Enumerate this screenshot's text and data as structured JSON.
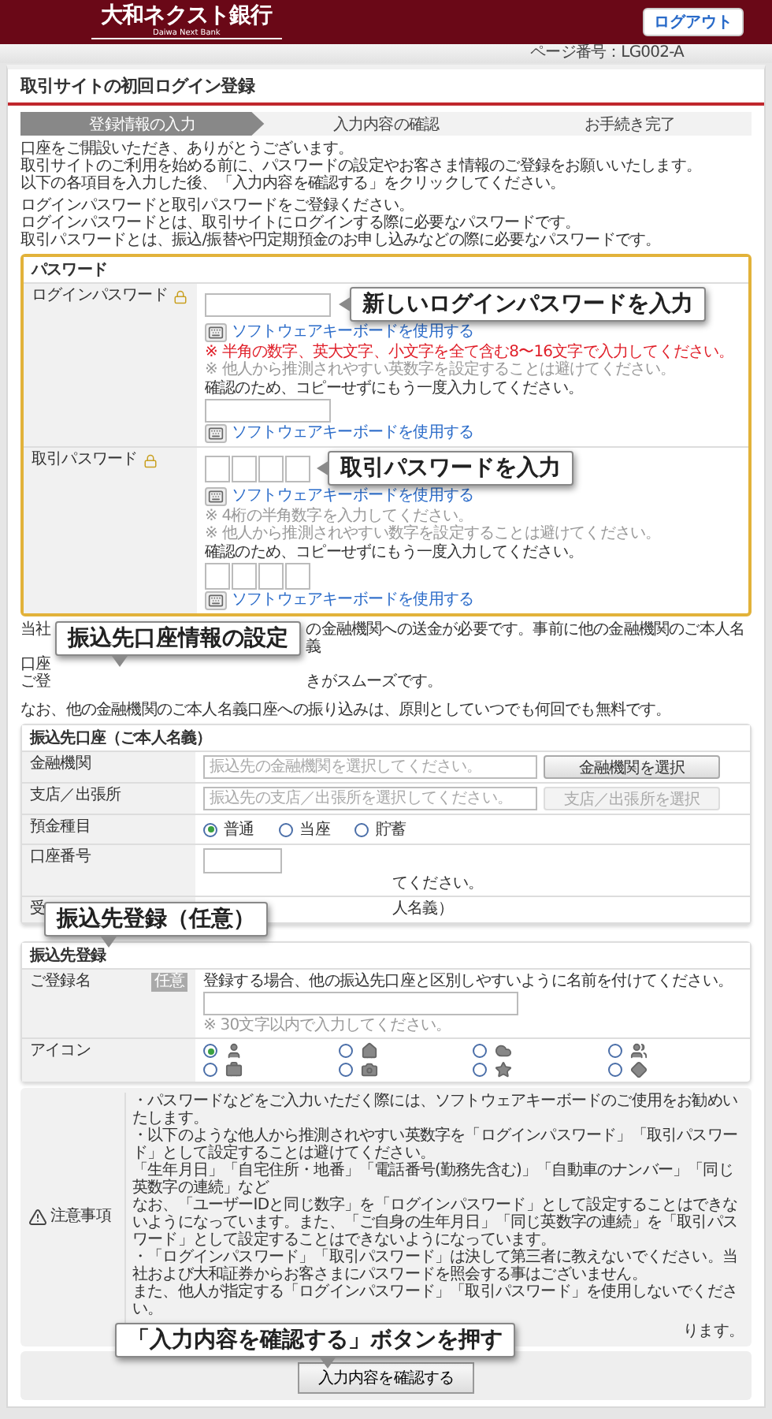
{
  "header": {
    "logo": "大和ネクスト銀行",
    "logo_subtitle": "Daiwa Next Bank",
    "logout_button": "ログアウト"
  },
  "page_number": "ページ番号：LG002-A",
  "page_title": "取引サイトの初回ログイン登録",
  "steps": [
    {
      "label": "登録情報の入力",
      "selected": true
    },
    {
      "label": "入力内容の確認",
      "selected": false
    },
    {
      "label": "お手続き完了",
      "selected": false
    }
  ],
  "intro": [
    "口座をご開設いただき、ありがとうございます。",
    "取引サイトのご利用を始める前に、パスワードの設定やお客さま情報のご登録をお願いいたします。",
    "以下の各項目を入力した後、「入力内容を確認する」をクリックしてください。"
  ],
  "password_intro": [
    "ログインパスワードと取引パスワードをご登録ください。",
    "ログインパスワードとは、取引サイトにログインする際に必要なパスワードです。",
    "取引パスワードとは、振込/振替や円定期預金のお申し込みなどの際に必要なパスワードです。"
  ],
  "password": {
    "title": "パスワード",
    "rows": [
      {
        "kind": "text",
        "label": "ログインパスワード",
        "callout": "新しいログインパスワードを入力",
        "keyboard_link": "ソフトウェアキーボードを使用する",
        "notes": [
          {
            "text": "※ 半角の数字、英大文字、小文字を全て含む8〜16文字で入力してください。",
            "warning": true
          },
          {
            "text": "※ 他人から推測されやすい英数字を設定することは避けてください。",
            "warning": false
          }
        ],
        "confirm_label": "確認のため、コピーせずにもう一度入力してください。",
        "confirm_keyboard_link": "ソフトウェアキーボードを使用する"
      },
      {
        "kind": "digits",
        "label": "取引パスワード",
        "callout": "取引パスワードを入力",
        "keyboard_link": "ソフトウェアキーボードを使用する",
        "notes": [
          {
            "text": "※ 4桁の半角数字を入力してください。",
            "warning": false
          },
          {
            "text": "※ 他人から推測されやすい数字を設定することは避けてください。",
            "warning": false
          }
        ],
        "confirm_label": "確認のため、コピーせずにもう一度入力してください。",
        "confirm_keyboard_link": "ソフトウェアキーボードを使用する"
      }
    ]
  },
  "transfer_notice": {
    "callout": "振込先口座情報の設定",
    "lines": [
      {
        "left": "当社",
        "right": "の金融機関への送金が必要です。事前に他の金融機関のご本人名義"
      },
      {
        "left": "口座"
      },
      {
        "left": "ご登",
        "right": "きがスムーズです。"
      }
    ],
    "last_line": "なお、他の金融機関のご本人名義口座への振り込みは、原則としていつでも何回でも無料です。"
  },
  "account": {
    "title": "振込先口座（ご本人名義）",
    "callout": "振込先登録（任意）",
    "rows": [
      {
        "kind": "select",
        "label": "金融機関",
        "placeholder": "振込先の金融機関を選択してください。",
        "button": "金融機関を選択",
        "disabled": false
      },
      {
        "kind": "select",
        "label": "支店／出張所",
        "placeholder": "振込先の支店／出張所を選択してください。",
        "button": "支店／出張所を選択",
        "disabled": true
      },
      {
        "kind": "radio",
        "label": "預金種目",
        "options": [
          {
            "label": "普通",
            "selected": true
          },
          {
            "label": "当座",
            "selected": false
          },
          {
            "label": "貯蓄",
            "selected": false
          }
        ]
      },
      {
        "kind": "number",
        "label": "口座番号",
        "helper": "てください。"
      },
      {
        "kind": "partial",
        "label": "受",
        "value": "人名義）"
      }
    ]
  },
  "registration": {
    "title": "振込先登録",
    "name_row": {
      "label": "ご登録名",
      "badge": "任意",
      "description": "登録する場合、他の振込先口座と区別しやすいように名前を付けてください。",
      "note": "※ 30文字以内で入力してください。"
    },
    "icon_row": {
      "label": "アイコン",
      "options": [
        {
          "kind": "person",
          "selected": true
        },
        {
          "kind": "house",
          "selected": false
        },
        {
          "kind": "cloud",
          "selected": false
        },
        {
          "kind": "people",
          "selected": false
        },
        {
          "kind": "briefcase",
          "selected": false
        },
        {
          "kind": "camera",
          "selected": false
        },
        {
          "kind": "star",
          "selected": false
        },
        {
          "kind": "diamond",
          "selected": false
        }
      ]
    }
  },
  "notes": {
    "label": "注意事項",
    "lines": [
      "・パスワードなどをご入力いただく際には、ソフトウェアキーボードのご使用をお勧めいたします。",
      "・以下のような他人から推測されやすい英数字を「ログインパスワード」「取引パスワード」として設定することは避けてください。",
      "「生年月日」「自宅住所・地番」「電話番号(勤務先含む)」「自動車のナンバー」「同じ英数字の連続」など",
      "なお、「ユーザーIDと同じ数字」を「ログインパスワード」として設定することはできないようになっています。また、「ご自身の生年月日」「同じ英数字の連続」を「取引パスワード」として設定することはできないようになっています。",
      "・「ログインパスワード」「取引パスワード」は決して第三者に教えないでください。当社および大和証券からお客さまにパスワードを照会する事はございません。",
      "また、他人が指定する「ログインパスワード」「取引パスワード」を使用しないでください。"
    ],
    "last_fragment": "ります。"
  },
  "submit": {
    "callout": "「入力内容を確認する」ボタンを押す",
    "button": "入力内容を確認する"
  }
}
